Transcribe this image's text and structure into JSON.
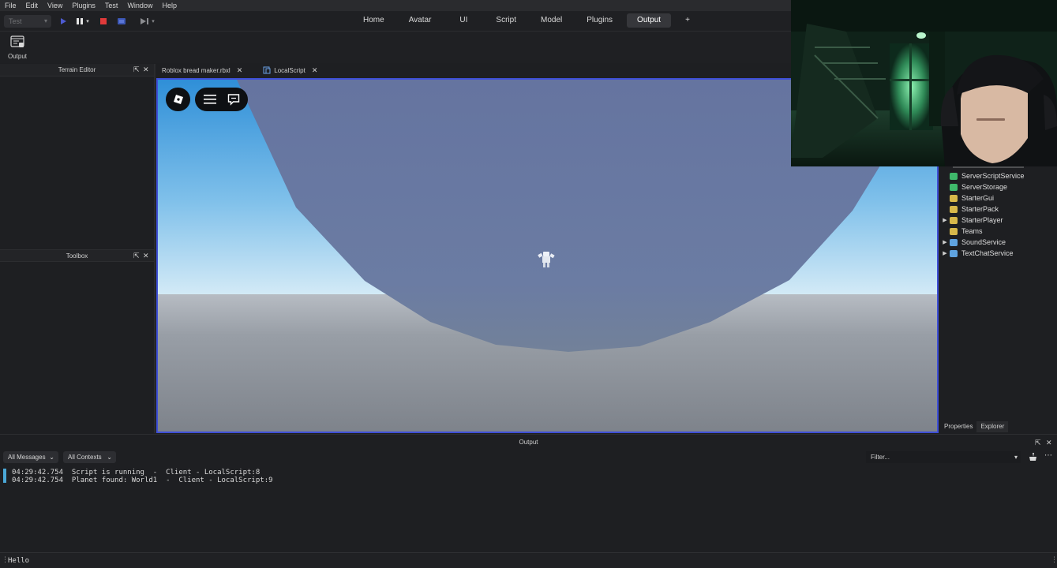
{
  "menu": [
    "File",
    "Edit",
    "View",
    "Plugins",
    "Test",
    "Window",
    "Help"
  ],
  "toolbar": {
    "mode_value": "Test",
    "ribbon_tabs": [
      "Home",
      "Avatar",
      "UI",
      "Script",
      "Model",
      "Plugins",
      "Output",
      "+"
    ],
    "active_tab": "Output"
  },
  "ribbon": {
    "output_label": "Output"
  },
  "left_panels": {
    "terrain_title": "Terrain Editor",
    "toolbox_title": "Toolbox"
  },
  "doc_tabs": [
    {
      "label": "Roblox bread maker.rbxl"
    },
    {
      "label": "LocalScript"
    }
  ],
  "explorer": {
    "items": [
      {
        "label": "ServerScriptService",
        "icon": "server-script-service-icon",
        "expandable": false
      },
      {
        "label": "ServerStorage",
        "icon": "server-storage-icon",
        "expandable": false
      },
      {
        "label": "StarterGui",
        "icon": "folder-icon",
        "expandable": false
      },
      {
        "label": "StarterPack",
        "icon": "folder-icon",
        "expandable": false
      },
      {
        "label": "StarterPlayer",
        "icon": "folder-icon",
        "expandable": true
      },
      {
        "label": "Teams",
        "icon": "folder-icon",
        "expandable": false
      },
      {
        "label": "SoundService",
        "icon": "sound-service-icon",
        "expandable": true
      },
      {
        "label": "TextChatService",
        "icon": "chat-service-icon",
        "expandable": true
      }
    ],
    "tabs": [
      "Properties",
      "Explorer"
    ],
    "active_tab": "Explorer"
  },
  "output": {
    "title": "Output",
    "messages_filter": "All Messages",
    "contexts_filter": "All Contexts",
    "filter_placeholder": "Filter...",
    "logs": [
      "04:29:42.754  Script is running  -  Client - LocalScript:8",
      "04:29:42.754  Planet found: World1  -  Client - LocalScript:9"
    ]
  },
  "command_bar": {
    "value": "Hello"
  },
  "colors": {
    "accent": "#3e4fd6",
    "sky_top": "#2f8fd8",
    "sky_horizon": "#d7ecf7",
    "planet": "#6879a0",
    "ground": "#8a8f97",
    "log_marker": "#4aa7d6"
  }
}
